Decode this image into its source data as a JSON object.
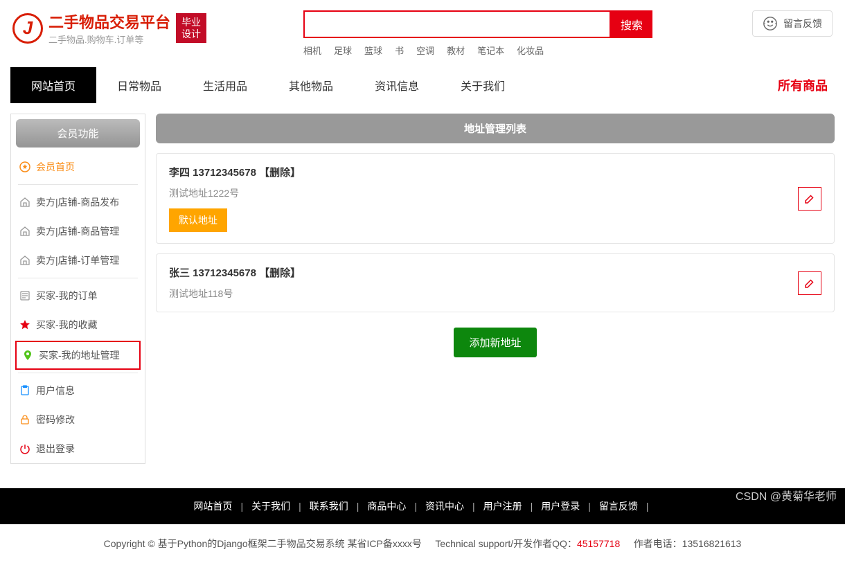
{
  "header": {
    "site_title": "二手物品交易平台",
    "site_subtitle": "二手物品.购物车.订单等",
    "badge_line1": "毕业",
    "badge_line2": "设计",
    "search_btn": "搜索",
    "feedback": "留言反馈",
    "hot_words": [
      "相机",
      "足球",
      "篮球",
      "书",
      "空调",
      "教材",
      "笔记本",
      "化妆品"
    ]
  },
  "nav": {
    "items": [
      "网站首页",
      "日常物品",
      "生活用品",
      "其他物品",
      "资讯信息",
      "关于我们"
    ],
    "right": "所有商品"
  },
  "sidebar": {
    "title": "会员功能",
    "items": [
      {
        "label": "会员首页",
        "icon": "star-circle",
        "highlight": true
      },
      {
        "sep": true
      },
      {
        "label": "卖方|店铺-商品发布",
        "icon": "home"
      },
      {
        "label": "卖方|店铺-商品管理",
        "icon": "home"
      },
      {
        "label": "卖方|店铺-订单管理",
        "icon": "home"
      },
      {
        "sep": true
      },
      {
        "label": "买家-我的订单",
        "icon": "list"
      },
      {
        "label": "买家-我的收藏",
        "icon": "star",
        "star": true
      },
      {
        "label": "买家-我的地址管理",
        "icon": "pin",
        "active": true
      },
      {
        "sep": true
      },
      {
        "label": "用户信息",
        "icon": "clip"
      },
      {
        "label": "密码修改",
        "icon": "lock"
      },
      {
        "label": "退出登录",
        "icon": "power"
      }
    ]
  },
  "main": {
    "panel_title": "地址管理列表",
    "addresses": [
      {
        "name": "李四",
        "phone": "13712345678",
        "del": "【删除】",
        "detail": "测试地址1222号",
        "is_default": true
      },
      {
        "name": "张三",
        "phone": "13712345678",
        "del": "【删除】",
        "detail": "测试地址118号",
        "is_default": false
      }
    ],
    "default_label": "默认地址",
    "add_btn": "添加新地址"
  },
  "footer": {
    "links": [
      "网站首页",
      "关于我们",
      "联系我们",
      "商品中心",
      "资讯中心",
      "用户注册",
      "用户登录",
      "留言反馈"
    ]
  },
  "copyright": {
    "left": "Copyright © 基于Python的Django框架二手物品交易系统 某省ICP备xxxx号",
    "tech": "Technical support/开发作者QQ：",
    "qq": "45157718",
    "author": "作者电话：13516821613"
  },
  "watermark": "CSDN @黄菊华老师"
}
